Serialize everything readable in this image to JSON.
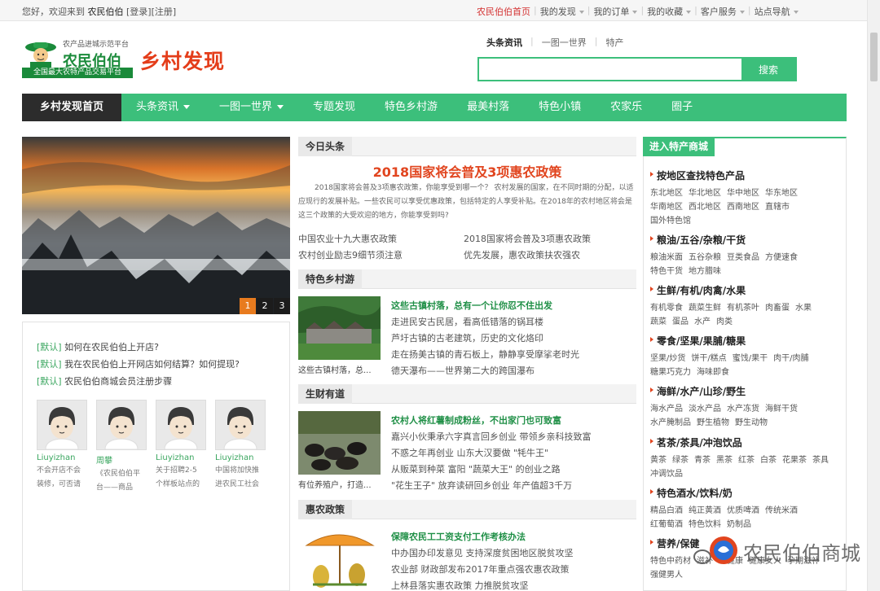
{
  "topbar": {
    "welcome_prefix": "您好，欢迎来到",
    "welcome_brand": "农民伯伯",
    "login": "[登录]",
    "register": "[注册]",
    "links": [
      {
        "label": "农民伯伯首页",
        "caret": false
      },
      {
        "label": "我的发现",
        "caret": true
      },
      {
        "label": "我的订单",
        "caret": true
      },
      {
        "label": "我的收藏",
        "caret": true
      },
      {
        "label": "客户服务",
        "caret": true
      },
      {
        "label": "站点导航",
        "caret": true
      }
    ]
  },
  "logo": {
    "tagline": "农产品进城示范平台",
    "name": "农民伯伯",
    "bar": "全国最大农特产品交易平台"
  },
  "site_title": "乡村发现",
  "search": {
    "tabs": [
      "头条资讯",
      "一图一世界",
      "特产"
    ],
    "button": "搜索",
    "value": ""
  },
  "nav": {
    "items": [
      {
        "label": "乡村发现首页",
        "caret": false
      },
      {
        "label": "头条资讯",
        "caret": true
      },
      {
        "label": "一图一世界",
        "caret": true
      },
      {
        "label": "专题发现",
        "caret": false
      },
      {
        "label": "特色乡村游",
        "caret": false
      },
      {
        "label": "最美村落",
        "caret": false
      },
      {
        "label": "特色小镇",
        "caret": false
      },
      {
        "label": "农家乐",
        "caret": false
      },
      {
        "label": "圈子",
        "caret": false
      }
    ]
  },
  "banner": {
    "pages": [
      "1",
      "2",
      "3"
    ],
    "active": 0
  },
  "notices": [
    {
      "tag": "[默认]",
      "text": "如何在农民伯伯上开店?"
    },
    {
      "tag": "[默认]",
      "text": "我在农民伯伯上开网店如何结算？如何提现?"
    },
    {
      "tag": "[默认]",
      "text": "农民伯伯商城会员注册步骤"
    }
  ],
  "users": [
    {
      "name": "Liuyizhan",
      "desc1": "不会开店不会",
      "desc2": "装修，可否请"
    },
    {
      "name": "周攀",
      "desc1": "《农民伯伯平",
      "desc2": "台——商品"
    },
    {
      "name": "Liuyizhan",
      "desc1": "关于招聘2-5",
      "desc2": "个样板站点的"
    },
    {
      "name": "Liuyizhan",
      "desc1": "中国将加快推",
      "desc2": "进农民工社会"
    }
  ],
  "today": {
    "label": "今日头条",
    "headline": "2018国家将会普及3项惠农政策",
    "summary": "2018国家将会普及3项惠农政策，你能享受到哪一个？ 农村发展的国家，在不同时期的分配，以适应现行的发展补贴。一些农民可以享受优惠政策，包括特定的人享受补贴。在2018年的农村地区将会是这三个政策的大受欢迎的地方，你能享受到吗?",
    "links": [
      "中国农业十九大惠农政策",
      "2018国家将会普及3项惠农政策",
      "农村创业励志9细节须注意",
      "优先发展，惠农政策扶农强农"
    ]
  },
  "sections": [
    {
      "label": "特色乡村游",
      "caption": "这些古镇村落，总...",
      "title": "这些古镇村落，总有一个让你忍不住出发",
      "lines": [
        "走进民安古民居，看高低错落的锅耳楼",
        "芦圩古镇的古老建筑，历史的文化烙印",
        "走在扬美古镇的青石板上，静静享受摩挲老时光",
        "德天瀑布——世界第二大的跨国瀑布"
      ]
    },
    {
      "label": "生财有道",
      "caption": "有位养殖户，打造...",
      "title": "农村人将红薯制成粉丝，不出家门也可致富",
      "lines": [
        "嘉兴小伙秉承六字真言回乡创业 带领乡亲科技致富",
        "不惑之年再创业 山东大汉要做 \"牦牛王\"",
        "从贩菜到种菜 富阳 \"蔬菜大王\" 的创业之路",
        "\"花生王子\" 放弃读研回乡创业 年产值超3千万"
      ]
    },
    {
      "label": "惠农政策",
      "caption": "",
      "title": "保障农民工工资支付工作考核办法",
      "lines": [
        "中办国办印发意见 支持深度贫困地区脱贫攻坚",
        "农业部 财政部发布2017年重点强农惠农政策",
        "上林县落实惠农政策 力推脱贫攻坚"
      ]
    }
  ],
  "right": {
    "head": "进入特产商城",
    "cats": [
      {
        "title": "按地区查找特色产品",
        "subs": [
          "东北地区",
          "华北地区",
          "华中地区",
          "华东地区",
          "华南地区",
          "西北地区",
          "西南地区",
          "直辖市",
          "国外特色馆"
        ]
      },
      {
        "title": "粮油/五谷/杂粮/干货",
        "subs": [
          "粮油米面",
          "五谷杂粮",
          "豆类食品",
          "方便速食",
          "特色干货",
          "地方腊味"
        ]
      },
      {
        "title": "生鲜/有机/肉禽/水果",
        "subs": [
          "有机零食",
          "蔬菜生鲜",
          "有机茶叶",
          "肉畜蛋",
          "水果",
          "蔬菜",
          "蛋品",
          "水产",
          "肉类"
        ]
      },
      {
        "title": "零食/坚果/果脯/糖果",
        "subs": [
          "坚果/炒货",
          "饼干/糕点",
          "蜜饯/果干",
          "肉干/肉脯",
          "糖果巧克力",
          "海味即食"
        ]
      },
      {
        "title": "海鲜/水产/山珍/野生",
        "subs": [
          "海水产品",
          "淡水产品",
          "水产冻货",
          "海鲜干货",
          "水产腌制品",
          "野生植物",
          "野生动物"
        ]
      },
      {
        "title": "茗茶/茶具/冲泡饮品",
        "subs": [
          "黄茶",
          "绿茶",
          "青茶",
          "黑茶",
          "红茶",
          "白茶",
          "花果茶",
          "茶具",
          "冲调饮品"
        ]
      },
      {
        "title": "特色酒水/饮料/奶",
        "subs": [
          "精品白酒",
          "纯正黄酒",
          "优质啤酒",
          "传统米酒",
          "红葡萄酒",
          "特色饮料",
          "奶制品"
        ]
      },
      {
        "title": "营养/保健",
        "subs": [
          "特色中药材",
          "滋补",
          "亚健康",
          "健康女人",
          "孕期滋补",
          "强健男人"
        ]
      }
    ]
  },
  "watermark": "农民伯伯商城",
  "colors": {
    "brand_green": "#3cbf7b",
    "accent_red": "#e1451f",
    "nav_dark": "#2c2c2c"
  }
}
